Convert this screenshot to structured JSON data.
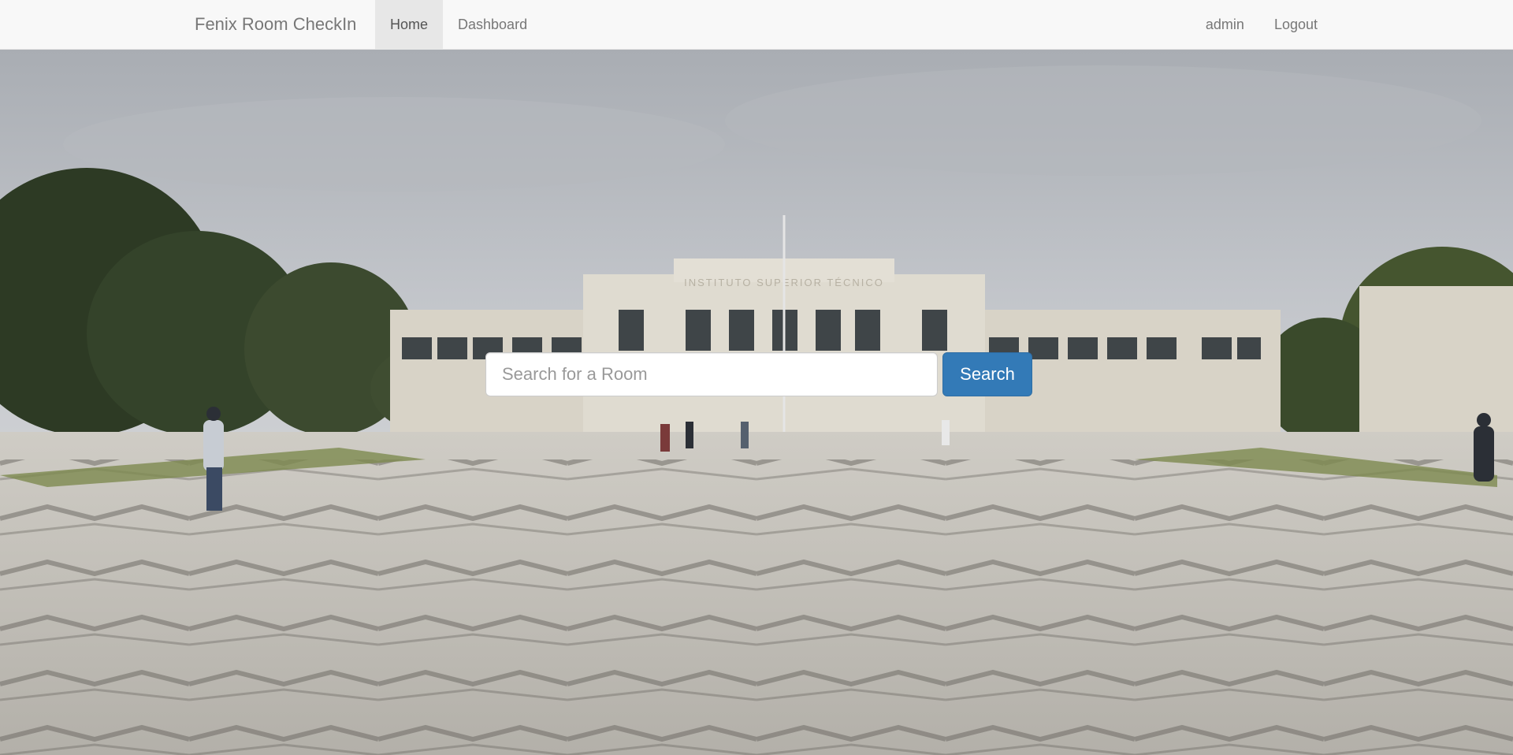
{
  "navbar": {
    "brand": "Fenix Room CheckIn",
    "links_left": [
      {
        "label": "Home",
        "active": true
      },
      {
        "label": "Dashboard",
        "active": false
      }
    ],
    "links_right": [
      {
        "label": "admin"
      },
      {
        "label": "Logout"
      }
    ]
  },
  "hero": {
    "building_inscription": "INSTITUTO SUPERIOR TÉCNICO"
  },
  "search": {
    "placeholder": "Search for a Room",
    "value": "",
    "button_label": "Search"
  },
  "colors": {
    "navbar_bg": "#f8f8f8",
    "active_tab_bg": "#e7e7e7",
    "primary_button": "#337ab7",
    "sky": "#b9bcc1",
    "pavement": "#c9c7c1"
  }
}
